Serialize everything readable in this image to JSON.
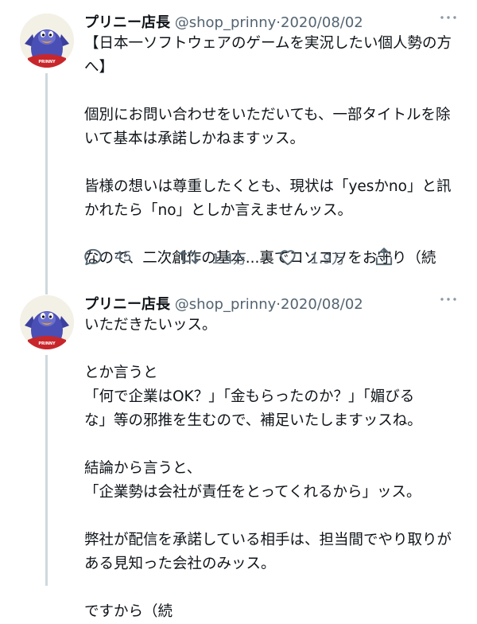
{
  "tweets": [
    {
      "name": "プリニー店長",
      "handle": "@shop_prinny",
      "date": "2020/08/02",
      "lines": [
        "【日本一ソフトウェアのゲームを実況したい個人勢の方",
        "へ】",
        "",
        "個別にお問い合わせをいただいても、一部タイトルを除",
        "いて基本は承諾しかねますッス。",
        "",
        "皆様の想いは尊重したくとも、現状は「yesかno」と訊",
        "かれたら「no」としか言えませんッス。",
        "",
        "なので、二次創作の基本...裏でコソコソをお守り（続"
      ],
      "replies": "45",
      "retweets": "1.4万",
      "likes": "1.9万"
    },
    {
      "name": "プリニー店長",
      "handle": "@shop_prinny",
      "date": "2020/08/02",
      "lines": [
        "いただきたいッス。",
        "",
        "とか言うと",
        "「何で企業はOK？」「金もらったのか？」「媚びる",
        "な」等の邪推を生むので、補足いたしますッスね。",
        "",
        "結論から言うと、",
        "「企業勢は会社が責任をとってくれるから」ッス。",
        "",
        "弊社が配信を承諾している相手は、担当間でやり取りが",
        "ある見知った会社のみッス。",
        "",
        "ですから（続"
      ]
    }
  ],
  "separator": "·",
  "more_icon": "more-dots-icon",
  "avatar_text": "PRINNY",
  "colors": {
    "text": "#0f1419",
    "muted": "#536471",
    "thread": "#cfd9de",
    "avatar_bg": "#f3f0e6",
    "prinny_blue": "#3b3f9e",
    "prinny_red": "#c8262b"
  }
}
